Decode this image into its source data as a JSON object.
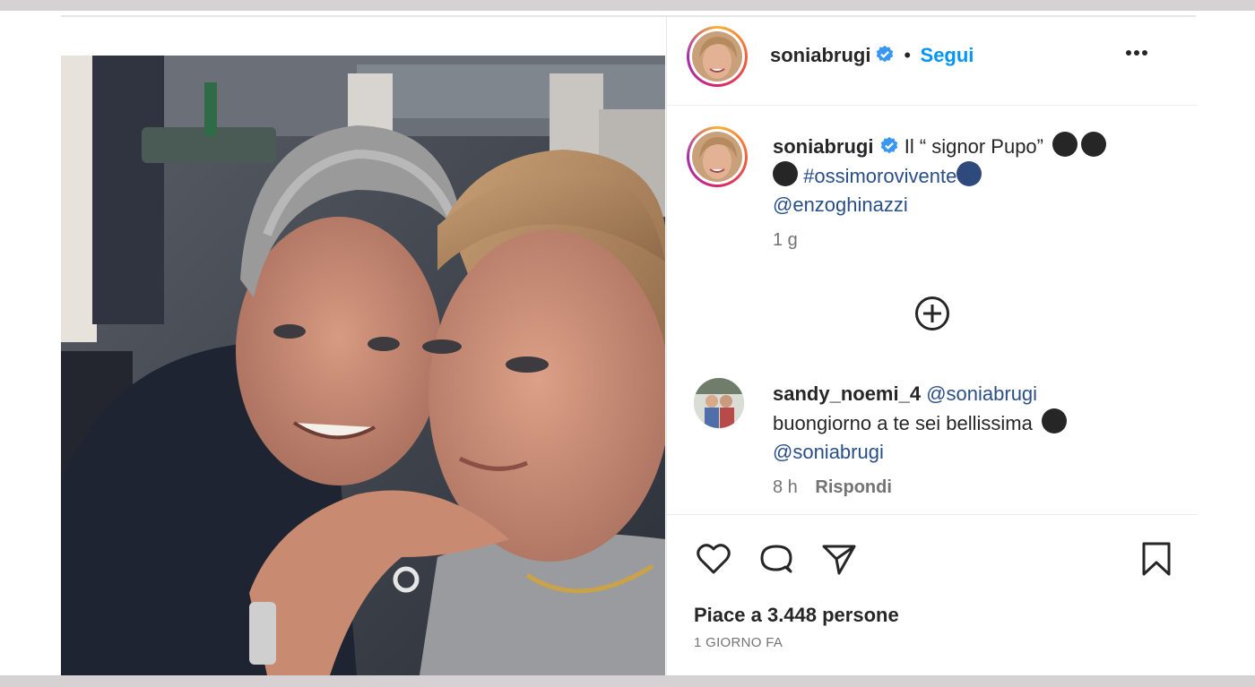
{
  "post": {
    "author": "soniabrugi",
    "separator": "•",
    "follow_label": "Segui",
    "more_icon": "more-horizontal-icon"
  },
  "caption": {
    "author": "soniabrugi",
    "text_start": "Il “ signor Pupo”",
    "hashtag": "#ossimorovivente",
    "mention": "@enzoghinazzi",
    "time": "1 g"
  },
  "add_comment_icon": "plus-circle-icon",
  "comment": {
    "author": "sandy_noemi_4",
    "mention": "@soniabrugi",
    "text": "buongiorno a te sei bellissima",
    "mention2": "@soniabrugi",
    "time": "8 h",
    "reply_label": "Rispondi"
  },
  "actions": {
    "icons": [
      "heart-icon",
      "comment-icon",
      "share-icon",
      "bookmark-icon"
    ]
  },
  "likes_text": "Piace a 3.448 persone",
  "date_text": "1 GIORNO FA",
  "colors": {
    "link_blue": "#0095f6",
    "hashtag_blue": "#2a4e86",
    "text": "#262626",
    "muted": "#737373",
    "frame": "#d6d1d3"
  }
}
